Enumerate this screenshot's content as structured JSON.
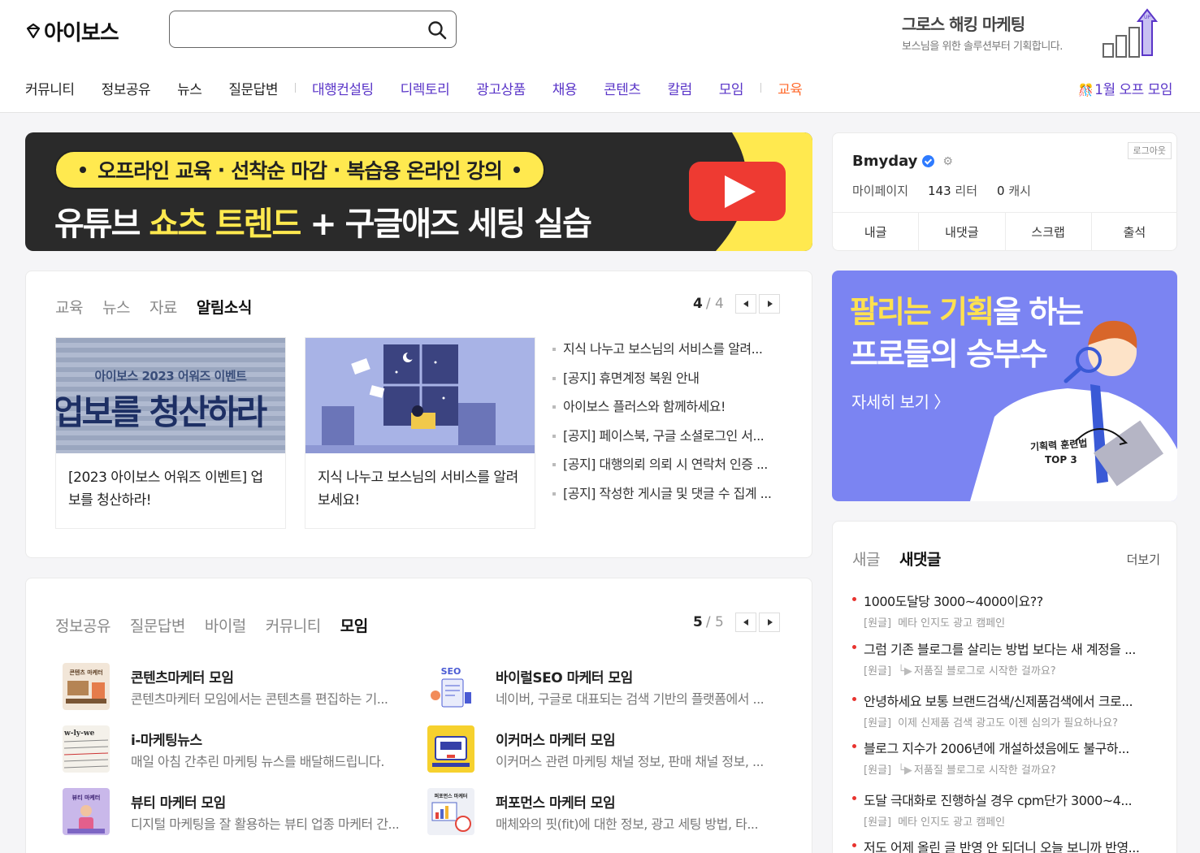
{
  "header": {
    "logo_text": "아이보스",
    "search_placeholder": "",
    "promo_title": "그로스 해킹 마케팅",
    "promo_sub": "보스님을 위한 솔루션부터 기획합니다.",
    "promo_icon_text": "UP"
  },
  "nav": {
    "main": [
      "커뮤니티",
      "정보공유",
      "뉴스",
      "질문답변"
    ],
    "purple": [
      "대행컨설팅",
      "디렉토리",
      "광고상품",
      "채용",
      "콘텐츠",
      "칼럼",
      "모임"
    ],
    "orange": "교육",
    "right": "1월 오프 모임"
  },
  "banner": {
    "pill_parts": [
      "오프라인 교육",
      "선착순 마감",
      "복습용 온라인 강의"
    ],
    "pill_sep": "·",
    "headline_pre": "유튜브 ",
    "headline_hl": "쇼츠 트렌드",
    "headline_post": " + 구글애즈 세팅 실습"
  },
  "edu_panel": {
    "tabs": [
      "교육",
      "뉴스",
      "자료",
      "알림소식"
    ],
    "active_tab": 3,
    "page_current": "4",
    "page_total": "/  4",
    "cards": [
      {
        "thumb_small": "아이보스 2023 어워즈 이벤트",
        "thumb_big": "업보를 청산하라",
        "text": "[2023 아이보스 어워즈 이벤트] 업보를 청산하라!"
      },
      {
        "text": "지식 나누고 보스님의 서비스를 알려보세요!"
      }
    ],
    "notices": [
      "지식 나누고 보스님의 서비스를 알려...",
      "[공지] 휴면계정 복원 안내",
      "아이보스 플러스와 함께하세요!",
      "[공지] 페이스북, 구글 소셜로그인 서...",
      "[공지] 대행의뢰 의뢰 시 연락처 인증 ...",
      "[공지] 작성한 게시글 및 댓글 수 집계 ..."
    ]
  },
  "group_panel": {
    "tabs": [
      "정보공유",
      "질문답변",
      "바이럴",
      "커뮤니티",
      "모임"
    ],
    "active_tab": 4,
    "page_current": "5",
    "page_total": "/  5",
    "groups": [
      {
        "title": "콘텐츠마케터 모임",
        "desc": "콘텐츠마케터 모임에서는 콘텐츠를 편집하는 기...",
        "thumb_label": "콘텐츠 마케터"
      },
      {
        "title": "바이럴SEO 마케터 모임",
        "desc": "네이버, 구글로 대표되는 검색 기반의 플랫폼에서 ...",
        "thumb_label": "SEO"
      },
      {
        "title": "i-마케팅뉴스",
        "desc": "매일 아침 간추린 마케팅 뉴스를 배달해드립니다.",
        "thumb_label": "w-ly-we"
      },
      {
        "title": "이커머스 마케터 모임",
        "desc": "이커머스 관련 마케팅 채널 정보, 판매 채널 정보, ...",
        "thumb_label": ""
      },
      {
        "title": "뷰티 마케터 모임",
        "desc": "디지털 마케팅을 잘 활용하는 뷰티 업종 마케터 간...",
        "thumb_label": "뷰티 마케터"
      },
      {
        "title": "퍼포먼스 마케터 모임",
        "desc": "매체와의 핏(fit)에 대한 정보, 광고 세팅 방법, 타...",
        "thumb_label": "퍼포먼스 마케터"
      }
    ]
  },
  "profile": {
    "name": "Bmyday",
    "logout": "로그아웃",
    "mypage": "마이페이지",
    "liter_num": "143",
    "liter_unit": " 리터",
    "cash_num": "0",
    "cash_unit": " 캐시",
    "tabs": [
      "내글",
      "내댓글",
      "스크랩",
      "출석"
    ]
  },
  "ad": {
    "line1_hl": "팔리는 기획",
    "line1_post": "을 하는",
    "line2": "프로들의 승부수",
    "more": "자세히 보기 〉",
    "caption1": "기획력 훈련법",
    "caption2": "TOP 3"
  },
  "comments_panel": {
    "tabs": [
      "새글",
      "새댓글"
    ],
    "active_tab": 1,
    "more": "더보기",
    "items": [
      {
        "title": "1000도달당 3000~4000이요??",
        "tag": "[원글]",
        "arrow": "",
        "sub": "메타 인지도 광고 캠페인"
      },
      {
        "title": "그럼 기존 블로그를 살리는 방법 보다는 새 계정을 ...",
        "tag": "[원글]",
        "arrow": "└▶",
        "sub": "저품질 블로그로 시작한 걸까요?"
      },
      {
        "title": "안녕하세요 보통 브랜드검색/신제품검색에서 크로...",
        "tag": "[원글]",
        "arrow": "",
        "sub": "이제 신제품 검색 광고도 이젠 심의가 필요하나요?"
      },
      {
        "title": "블로그 지수가 2006년에 개설하셨음에도 불구하...",
        "tag": "[원글]",
        "arrow": "└▶",
        "sub": "저품질 블로그로 시작한 걸까요?"
      },
      {
        "title": "도달 극대화로 진행하실 경우 cpm단가 3000~4...",
        "tag": "[원글]",
        "arrow": "",
        "sub": "메타 인지도 광고 캠페인"
      },
      {
        "title": "저도 어제 올린 글 반영 안 되더니 오늘 보니까 반영...",
        "tag": "",
        "arrow": "",
        "sub": ""
      }
    ]
  },
  "colors": {
    "accent_purple": "#5a35c8",
    "accent_orange": "#ff6a2c",
    "banner_yellow": "#ffe94f",
    "ad_bg": "#7b84f2",
    "comment_dot": "#e8332e"
  }
}
